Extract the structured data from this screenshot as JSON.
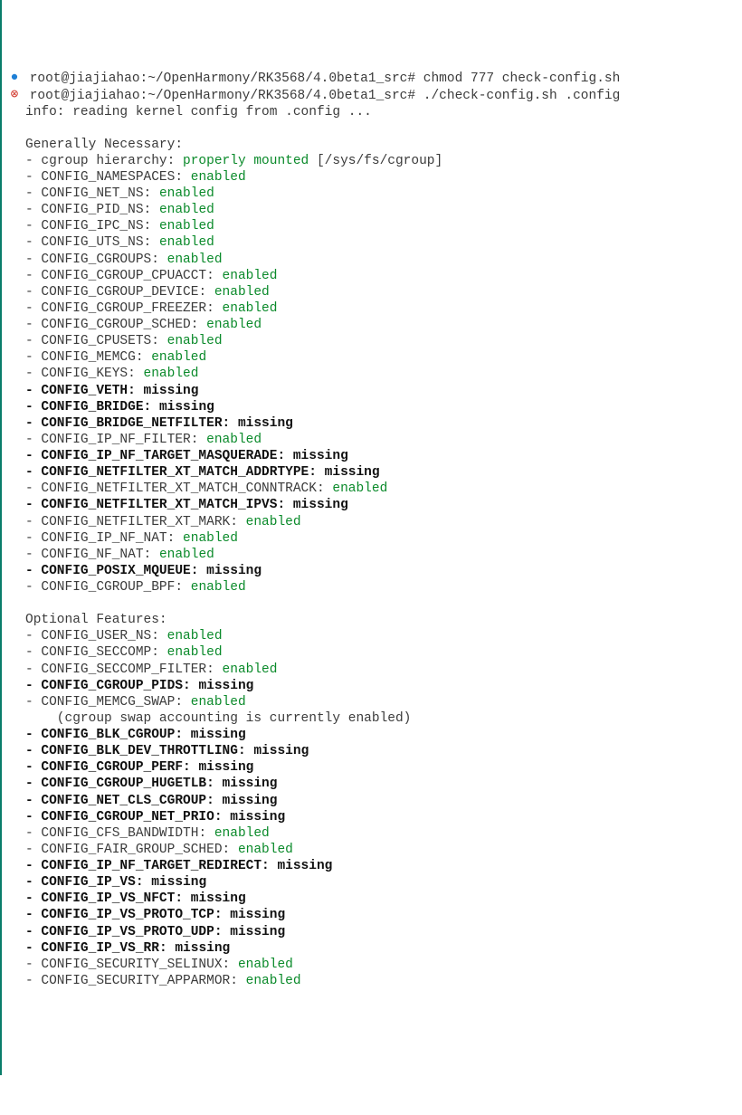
{
  "line1": {
    "prompt": "root@jiajiahao:~/OpenHarmony/RK3568/4.0beta1_src#",
    "cmd": " chmod 777 check-config.sh"
  },
  "line2": {
    "prompt": "root@jiajiahao:~/OpenHarmony/RK3568/4.0beta1_src#",
    "cmd": " ./check-config.sh .config"
  },
  "info": "info: reading kernel config from .config ...",
  "section1": "Generally Necessary:",
  "cgroup_prefix": "- cgroup hierarchy: ",
  "cgroup_status": "properly mounted",
  "cgroup_suffix": " [/sys/fs/cgroup]",
  "gn": [
    {
      "name": "CONFIG_NAMESPACES",
      "status": "enabled",
      "miss": false
    },
    {
      "name": "CONFIG_NET_NS",
      "status": "enabled",
      "miss": false
    },
    {
      "name": "CONFIG_PID_NS",
      "status": "enabled",
      "miss": false
    },
    {
      "name": "CONFIG_IPC_NS",
      "status": "enabled",
      "miss": false
    },
    {
      "name": "CONFIG_UTS_NS",
      "status": "enabled",
      "miss": false
    },
    {
      "name": "CONFIG_CGROUPS",
      "status": "enabled",
      "miss": false
    },
    {
      "name": "CONFIG_CGROUP_CPUACCT",
      "status": "enabled",
      "miss": false
    },
    {
      "name": "CONFIG_CGROUP_DEVICE",
      "status": "enabled",
      "miss": false
    },
    {
      "name": "CONFIG_CGROUP_FREEZER",
      "status": "enabled",
      "miss": false
    },
    {
      "name": "CONFIG_CGROUP_SCHED",
      "status": "enabled",
      "miss": false
    },
    {
      "name": "CONFIG_CPUSETS",
      "status": "enabled",
      "miss": false
    },
    {
      "name": "CONFIG_MEMCG",
      "status": "enabled",
      "miss": false
    },
    {
      "name": "CONFIG_KEYS",
      "status": "enabled",
      "miss": false
    },
    {
      "name": "CONFIG_VETH",
      "status": "missing",
      "miss": true
    },
    {
      "name": "CONFIG_BRIDGE",
      "status": "missing",
      "miss": true
    },
    {
      "name": "CONFIG_BRIDGE_NETFILTER",
      "status": "missing",
      "miss": true
    },
    {
      "name": "CONFIG_IP_NF_FILTER",
      "status": "enabled",
      "miss": false
    },
    {
      "name": "CONFIG_IP_NF_TARGET_MASQUERADE",
      "status": "missing",
      "miss": true
    },
    {
      "name": "CONFIG_NETFILTER_XT_MATCH_ADDRTYPE",
      "status": "missing",
      "miss": true
    },
    {
      "name": "CONFIG_NETFILTER_XT_MATCH_CONNTRACK",
      "status": "enabled",
      "miss": false
    },
    {
      "name": "CONFIG_NETFILTER_XT_MATCH_IPVS",
      "status": "missing",
      "miss": true
    },
    {
      "name": "CONFIG_NETFILTER_XT_MARK",
      "status": "enabled",
      "miss": false
    },
    {
      "name": "CONFIG_IP_NF_NAT",
      "status": "enabled",
      "miss": false
    },
    {
      "name": "CONFIG_NF_NAT",
      "status": "enabled",
      "miss": false
    },
    {
      "name": "CONFIG_POSIX_MQUEUE",
      "status": "missing",
      "miss": true
    },
    {
      "name": "CONFIG_CGROUP_BPF",
      "status": "enabled",
      "miss": false
    }
  ],
  "section2": "Optional Features:",
  "swap_note": "    (cgroup swap accounting is currently enabled)",
  "of": [
    {
      "name": "CONFIG_USER_NS",
      "status": "enabled",
      "miss": false
    },
    {
      "name": "CONFIG_SECCOMP",
      "status": "enabled",
      "miss": false
    },
    {
      "name": "CONFIG_SECCOMP_FILTER",
      "status": "enabled",
      "miss": false
    },
    {
      "name": "CONFIG_CGROUP_PIDS",
      "status": "missing",
      "miss": true
    },
    {
      "name": "CONFIG_MEMCG_SWAP",
      "status": "enabled",
      "miss": false,
      "note": true
    },
    {
      "name": "CONFIG_BLK_CGROUP",
      "status": "missing",
      "miss": true
    },
    {
      "name": "CONFIG_BLK_DEV_THROTTLING",
      "status": "missing",
      "miss": true
    },
    {
      "name": "CONFIG_CGROUP_PERF",
      "status": "missing",
      "miss": true
    },
    {
      "name": "CONFIG_CGROUP_HUGETLB",
      "status": "missing",
      "miss": true
    },
    {
      "name": "CONFIG_NET_CLS_CGROUP",
      "status": "missing",
      "miss": true
    },
    {
      "name": "CONFIG_CGROUP_NET_PRIO",
      "status": "missing",
      "miss": true
    },
    {
      "name": "CONFIG_CFS_BANDWIDTH",
      "status": "enabled",
      "miss": false
    },
    {
      "name": "CONFIG_FAIR_GROUP_SCHED",
      "status": "enabled",
      "miss": false
    },
    {
      "name": "CONFIG_IP_NF_TARGET_REDIRECT",
      "status": "missing",
      "miss": true
    },
    {
      "name": "CONFIG_IP_VS",
      "status": "missing",
      "miss": true
    },
    {
      "name": "CONFIG_IP_VS_NFCT",
      "status": "missing",
      "miss": true
    },
    {
      "name": "CONFIG_IP_VS_PROTO_TCP",
      "status": "missing",
      "miss": true
    },
    {
      "name": "CONFIG_IP_VS_PROTO_UDP",
      "status": "missing",
      "miss": true
    },
    {
      "name": "CONFIG_IP_VS_RR",
      "status": "missing",
      "miss": true
    },
    {
      "name": "CONFIG_SECURITY_SELINUX",
      "status": "enabled",
      "miss": false
    },
    {
      "name": "CONFIG_SECURITY_APPARMOR",
      "status": "enabled",
      "miss": false
    }
  ]
}
